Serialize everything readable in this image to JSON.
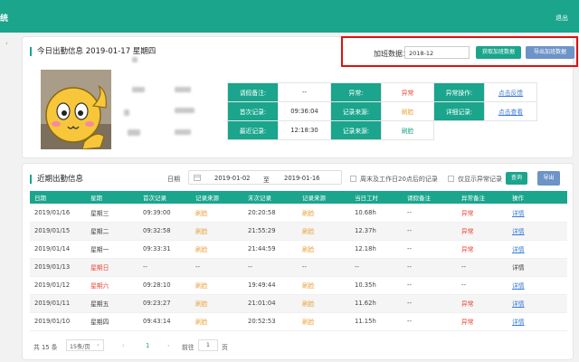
{
  "topbar": {
    "title": "统",
    "logout": "退出",
    "side_arrow": "‹"
  },
  "today": {
    "title": "今日出勤信息 2019-01-17 星期四",
    "overtime": {
      "label": "加班数据：",
      "month": "2018-12",
      "get_button": "获取加班数据",
      "export_button": "导出加班数据"
    },
    "info_rows": [
      [
        {
          "label": "请假备注:",
          "value": "--",
          "cls": ""
        },
        {
          "label": "异常:",
          "value": "异常",
          "cls": "red"
        },
        {
          "label": "异常操作:",
          "value": "点击反馈",
          "cls": "link"
        }
      ],
      [
        {
          "label": "首次记录:",
          "value": "09:36:04",
          "cls": ""
        },
        {
          "label": "记录来源:",
          "value": "刷脸",
          "cls": "orange"
        },
        {
          "label": "详细记录:",
          "value": "点击查看",
          "cls": "link"
        }
      ],
      [
        {
          "label": "最近记录:",
          "value": "12:18:30",
          "cls": ""
        },
        {
          "label": "记录来源:",
          "value": "刷脸",
          "cls": "green"
        }
      ]
    ]
  },
  "recent": {
    "title": "近期出勤信息",
    "date_label": "日期",
    "date_from": "2019-01-02",
    "date_sep": "至",
    "date_to": "2019-01-16",
    "opt1": "周末及工作日20点后的记录",
    "opt2": "仅显示异常记录",
    "query_button": "查询",
    "export_button": "导出",
    "columns": [
      "日期",
      "星期",
      "首次记录",
      "记录来源",
      "末次记录",
      "记录来源",
      "当日工时",
      "请假备注",
      "异常备注",
      "操作"
    ],
    "rows": [
      [
        "2019/01/16",
        "星期三",
        "09:39:00",
        "刷脸",
        "20:20:58",
        "刷脸",
        "10.68h",
        "--",
        "异常",
        "详情"
      ],
      [
        "2019/01/15",
        "星期二",
        "09:32:58",
        "刷脸",
        "21:55:29",
        "刷脸",
        "12.37h",
        "--",
        "异常",
        "详情"
      ],
      [
        "2019/01/14",
        "星期一",
        "09:33:31",
        "刷脸",
        "21:44:59",
        "刷脸",
        "12.18h",
        "--",
        "异常",
        "详情"
      ],
      [
        "2019/01/13",
        "星期日",
        "--",
        "--",
        "--",
        "--",
        "--",
        "--",
        "--",
        "详情"
      ],
      [
        "2019/01/12",
        "星期六",
        "09:28:10",
        "刷脸",
        "19:49:44",
        "刷脸",
        "10.35h",
        "--",
        "--",
        "详情"
      ],
      [
        "2019/01/11",
        "星期五",
        "09:23:27",
        "刷脸",
        "21:01:04",
        "刷脸",
        "11.62h",
        "--",
        "异常",
        "详情"
      ],
      [
        "2019/01/10",
        "星期四",
        "09:43:14",
        "刷脸",
        "20:52:53",
        "刷脸",
        "11.15h",
        "--",
        "异常",
        "详情"
      ]
    ]
  },
  "pagination": {
    "total": "共 15 条",
    "page_size": "15条/页",
    "prev": "‹",
    "page": "1",
    "next": "›",
    "goto_prefix": "前往",
    "goto_value": "1",
    "goto_suffix": "页"
  }
}
